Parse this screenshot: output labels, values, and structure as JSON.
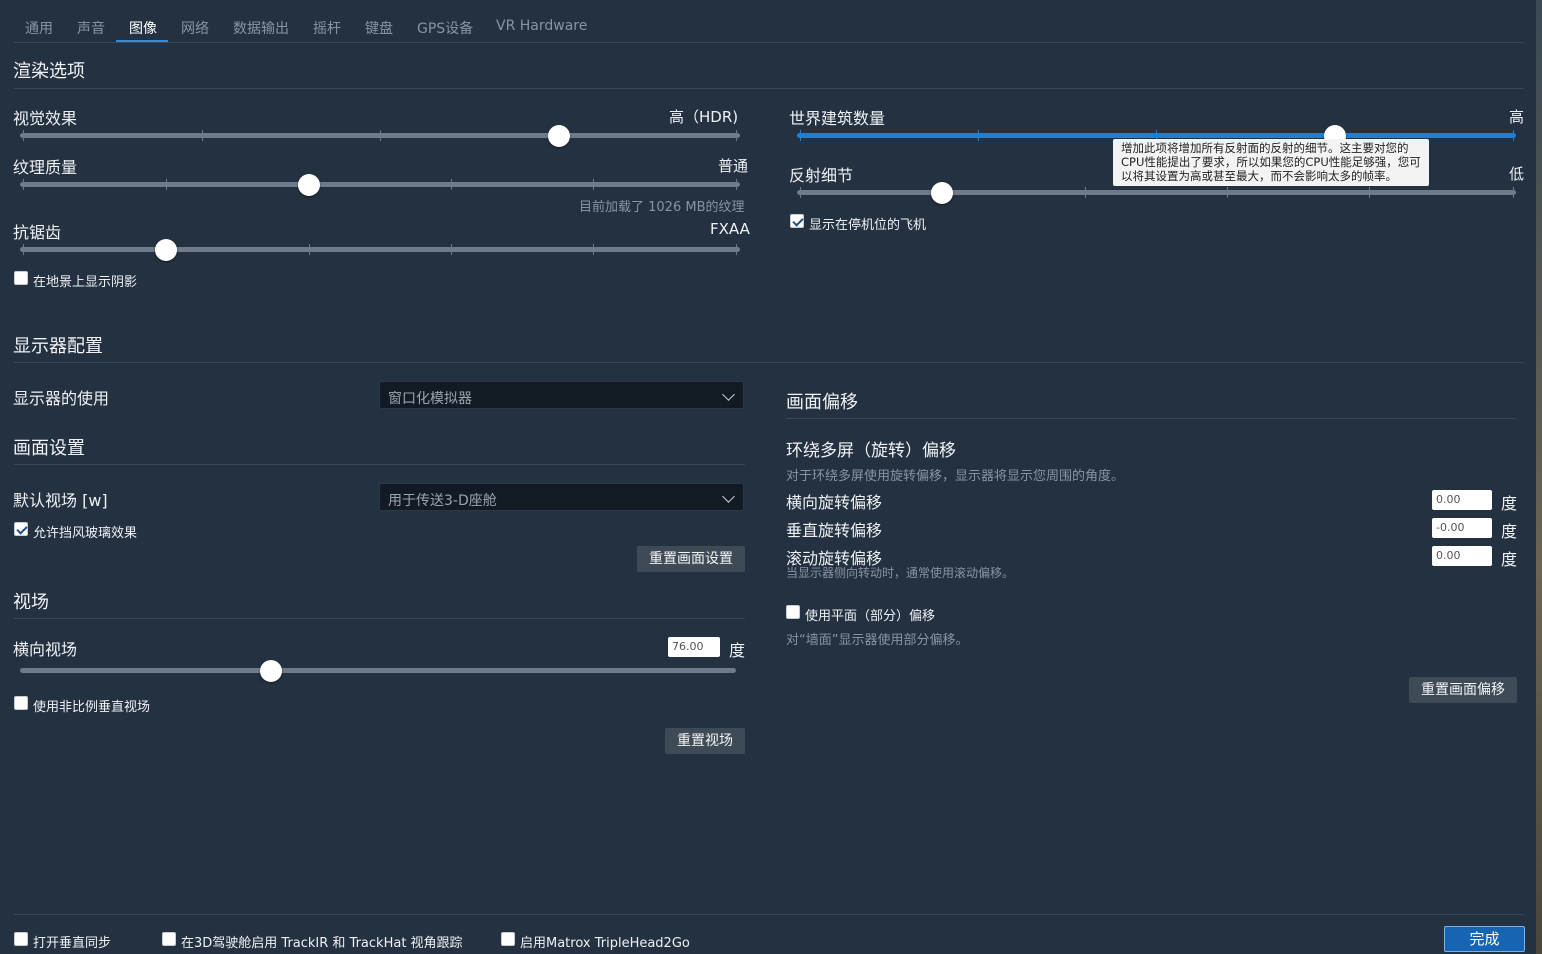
{
  "tabs": [
    "通用",
    "声音",
    "图像",
    "网络",
    "数据输出",
    "摇杆",
    "键盘",
    "GPS设备",
    "VR Hardware"
  ],
  "rendering": {
    "title": "渲染选项",
    "visual_effects": {
      "label": "视觉效果",
      "value": "高（HDR)",
      "position": 0.75
    },
    "texture_quality": {
      "label": "纹理质量",
      "value": "普通",
      "position": 0.4,
      "note": "目前加载了 1026 MB的纹理"
    },
    "antialiasing": {
      "label": "抗锯齿",
      "value": "FXAA",
      "position": 0.2
    },
    "shadows_checkbox": {
      "label": "在地景上显示阴影",
      "checked": false
    },
    "world_objects": {
      "label": "世界建筑数量",
      "value": "高",
      "position": 0.75
    },
    "reflection_detail": {
      "label": "反射细节",
      "value": "低",
      "position": 0.2
    },
    "tooltip": "增加此项将增加所有反射面的反射的细节。这主要对您的CPU性能提出了要求，所以如果您的CPU性能足够强，您可以将其设置为高或甚至最大，而不会影响太多的帧率。",
    "parked_aircraft": {
      "label": "显示在停机位的飞机",
      "checked": true
    }
  },
  "monitor": {
    "title": "显示器配置",
    "usage_label": "显示器的使用",
    "usage_value": "窗口化模拟器"
  },
  "view_settings": {
    "title": "画面设置",
    "default_view_label": "默认视场 [w]",
    "default_view_value": "用于传送3-D座舱",
    "windshield": {
      "label": "允许挡风玻璃效果",
      "checked": true
    },
    "reset_label": "重置画面设置"
  },
  "fov": {
    "title": "视场",
    "horizontal_label": "横向视场",
    "horizontal_value": "76.00",
    "unit": "度",
    "position": 0.35,
    "nonprop": {
      "label": "使用非比例垂直视场",
      "checked": false
    },
    "reset_label": "重置视场"
  },
  "offset": {
    "title": "画面偏移",
    "surround_title": "环绕多屏（旋转）偏移",
    "surround_desc": "对于环绕多屏使用旋转偏移，显示器将显示您周围的角度。",
    "rows": [
      {
        "label": "横向旋转偏移",
        "value": "0.00",
        "unit": "度"
      },
      {
        "label": "垂直旋转偏移",
        "value": "-0.00",
        "unit": "度"
      },
      {
        "label": "滚动旋转偏移",
        "value": "0.00",
        "unit": "度"
      }
    ],
    "roll_note": "当显示器侧向转动时，通常使用滚动偏移。",
    "planar": {
      "label": "使用平面（部分）偏移",
      "checked": false
    },
    "planar_note": "对“墙面”显示器使用部分偏移。",
    "reset_label": "重置画面偏移"
  },
  "footer": {
    "vsync": {
      "label": "打开垂直同步",
      "checked": false
    },
    "trackir": {
      "label": "在3D驾驶舱启用 TrackIR 和 TrackHat 视角跟踪",
      "checked": false
    },
    "matrox": {
      "label": "启用Matrox TripleHead2Go",
      "checked": false
    },
    "done_label": "完成"
  }
}
